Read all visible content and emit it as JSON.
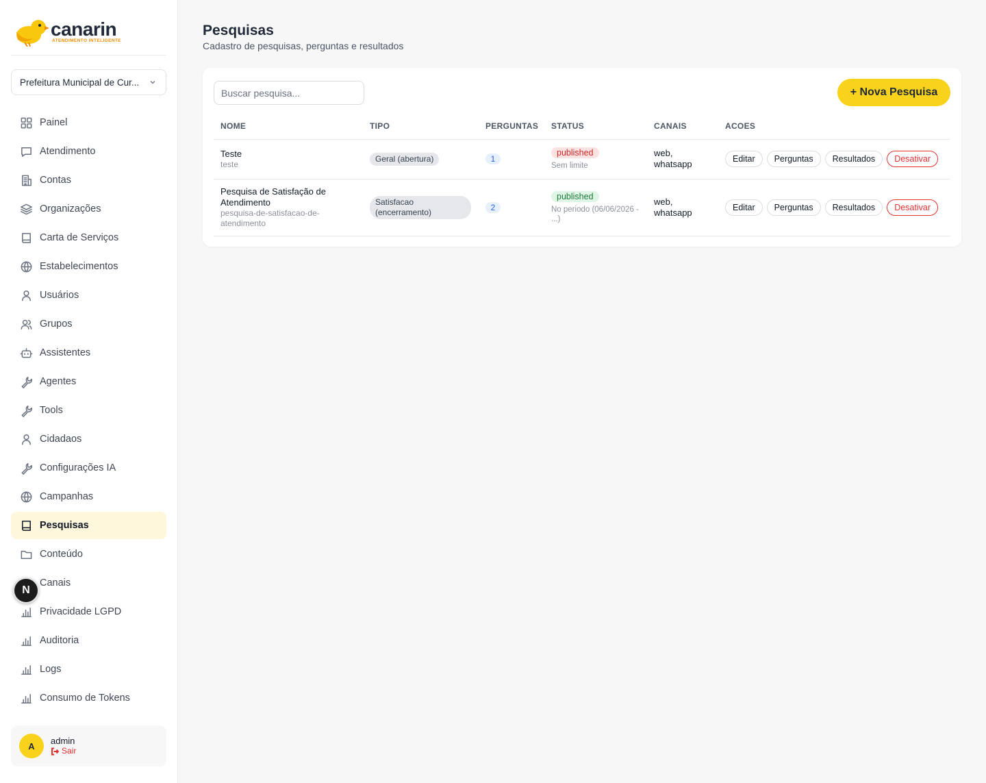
{
  "brand": {
    "name": "canarin",
    "tagline": "ATENDIMENTO INTELIGENTE",
    "accent": "#f9d21c"
  },
  "sidebar": {
    "org_select": "Prefeitura Municipal de Cur...",
    "items": [
      {
        "label": "Painel",
        "icon": "grid-icon"
      },
      {
        "label": "Atendimento",
        "icon": "chat-icon"
      },
      {
        "label": "Contas",
        "icon": "building-icon"
      },
      {
        "label": "Organizações",
        "icon": "layers-icon"
      },
      {
        "label": "Carta de Serviços",
        "icon": "book-icon"
      },
      {
        "label": "Estabelecimentos",
        "icon": "globe-icon"
      },
      {
        "label": "Usuários",
        "icon": "user-icon"
      },
      {
        "label": "Grupos",
        "icon": "users-icon"
      },
      {
        "label": "Assistentes",
        "icon": "bot-icon"
      },
      {
        "label": "Agentes",
        "icon": "wrench-icon"
      },
      {
        "label": "Tools",
        "icon": "wrench-icon"
      },
      {
        "label": "Cidadaos",
        "icon": "user-icon"
      },
      {
        "label": "Configurações IA",
        "icon": "wrench-icon"
      },
      {
        "label": "Campanhas",
        "icon": "globe-icon"
      },
      {
        "label": "Pesquisas",
        "icon": "book-icon",
        "active": true
      },
      {
        "label": "Conteúdo",
        "icon": "folder-icon"
      },
      {
        "label": "Canais",
        "icon": "bar-chart-icon"
      },
      {
        "label": "Privacidade LGPD",
        "icon": "bar-chart-icon"
      },
      {
        "label": "Auditoria",
        "icon": "bar-chart-icon"
      },
      {
        "label": "Logs",
        "icon": "bar-chart-icon"
      },
      {
        "label": "Consumo de Tokens",
        "icon": "bar-chart-icon"
      }
    ],
    "dev_badge": "N",
    "user": {
      "initial": "A",
      "name": "admin",
      "logout": "Sair"
    }
  },
  "header": {
    "title": "Pesquisas",
    "subtitle": "Cadastro de pesquisas, perguntas e resultados"
  },
  "toolbar": {
    "search_placeholder": "Buscar pesquisa...",
    "new_label": "+ Nova Pesquisa"
  },
  "table": {
    "columns": [
      "NOME",
      "TIPO",
      "PERGUNTAS",
      "STATUS",
      "CANAIS",
      "ACOES"
    ],
    "rows": [
      {
        "name": "Teste",
        "slug": "teste",
        "tipo": "Geral (abertura)",
        "perguntas": "1",
        "status": "published",
        "status_note": "Sem limite",
        "canais": "web, whatsapp",
        "actions": [
          "Editar",
          "Perguntas",
          "Resultados",
          "Desativar"
        ]
      },
      {
        "name": "Pesquisa de Satisfação de Atendimento",
        "slug": "pesquisa-de-satisfacao-de-atendimento",
        "tipo": "Satisfacao (encerramento)",
        "perguntas": "2",
        "status": "published",
        "status_note": "No periodo (06/06/2026 - ...)",
        "canais": "web, whatsapp",
        "actions": [
          "Editar",
          "Perguntas",
          "Resultados",
          "Desativar"
        ]
      }
    ]
  }
}
